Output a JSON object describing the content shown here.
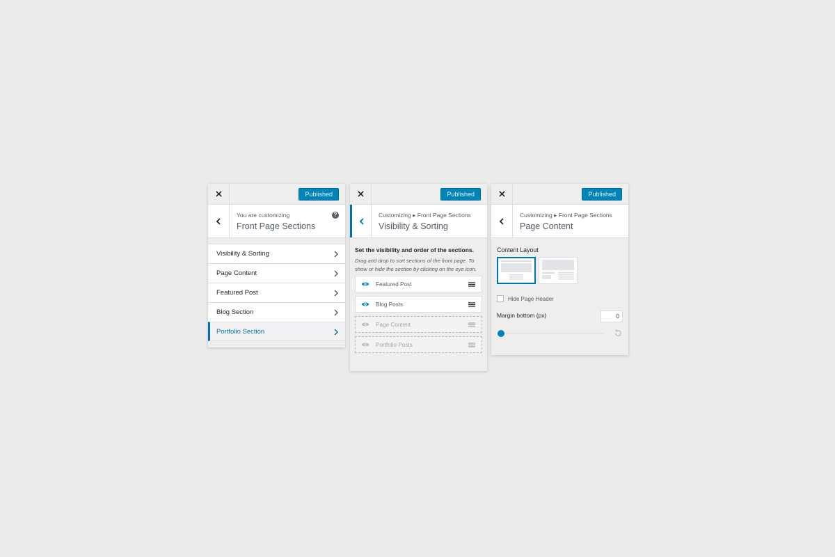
{
  "panel1": {
    "publish_label": "Published",
    "crumb": "You are customizing",
    "title": "Front Page Sections",
    "help_glyph": "?",
    "items": [
      {
        "label": "Visibility & Sorting",
        "active": false
      },
      {
        "label": "Page Content",
        "active": false
      },
      {
        "label": "Featured Post",
        "active": false
      },
      {
        "label": "Blog Section",
        "active": false
      },
      {
        "label": "Portfolio Section",
        "active": true
      }
    ]
  },
  "panel2": {
    "publish_label": "Published",
    "crumb": "Customizing ▸ Front Page Sections",
    "title": "Visibility & Sorting",
    "desc_title": "Set the visibility and order of the sections.",
    "desc": "Drag and drop to sort sections of the front page. To show or hide the section by clicking on the eye icon.",
    "sections": [
      {
        "label": "Featured Post",
        "visible": true
      },
      {
        "label": "Blog Posts",
        "visible": true
      },
      {
        "label": "Page Content",
        "visible": false
      },
      {
        "label": "Portfolio Posts",
        "visible": false
      }
    ]
  },
  "panel3": {
    "publish_label": "Published",
    "crumb": "Customizing ▸ Front Page Sections",
    "title": "Page Content",
    "content_layout_label": "Content Layout",
    "layout_options": [
      "full-width-layout-icon",
      "sidebar-layout-icon"
    ],
    "selected_layout": 0,
    "hide_header_label": "Hide Page Header",
    "hide_header_checked": false,
    "margin_label": "Margin bottom (px)",
    "margin_value": "0",
    "slider_fraction": 0
  },
  "colors": {
    "accent": "#0073aa",
    "button": "#0085ba",
    "background": "#ebebeb",
    "panel": "#eeeeee"
  },
  "icons": {
    "close": "close-icon",
    "back": "chevron-left-icon",
    "item": "chevron-right-icon",
    "eye": "eye-icon",
    "handle": "drag-handle-icon",
    "reset": "reset-icon",
    "help": "help-icon"
  }
}
